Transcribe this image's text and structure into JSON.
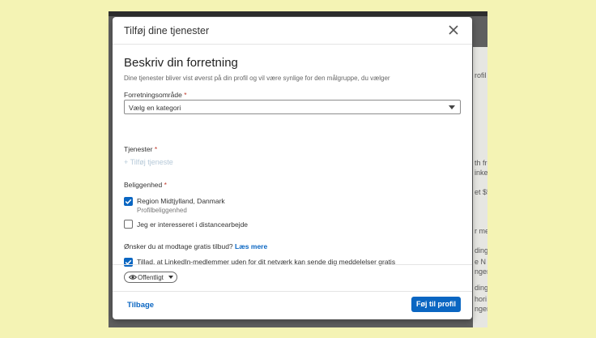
{
  "dialog": {
    "title": "Tilføj dine tjenester",
    "heading": "Beskriv din forretning",
    "subtitle": "Dine tjenester bliver vist øverst på din profil og vil være synlige for den målgruppe, du vælger",
    "required_mark": "*"
  },
  "business_area": {
    "label": "Forretningsområde",
    "selected": "Vælg en kategori"
  },
  "services": {
    "label": "Tjenester",
    "add_link": "+ Tilføj tjeneste"
  },
  "location": {
    "label": "Beliggenhed",
    "region": "Region Midtjylland, Danmark",
    "region_sub": "Profilbeliggenhed",
    "region_checked": true,
    "remote": "Jeg er interesseret i distancearbejde",
    "remote_checked": false
  },
  "offers": {
    "question": "Ønsker du at modtage gratis tilbud?",
    "learn_more": "Læs mere",
    "allow": "Tillad, at LinkedIn-medlemmer uden for dit netværk kan sende dig meddelelser gratis",
    "allow_checked": true
  },
  "footer": {
    "visibility": "Offentligt",
    "back": "Tilbage",
    "submit": "Føj til profil"
  },
  "background_peek": [
    "rofil",
    "th fre",
    "inke",
    "et $5",
    "r me",
    "ding",
    "e N",
    "nger",
    "ding",
    "hori",
    "nger"
  ],
  "colors": {
    "accent": "#0a66c2",
    "page_bg": "#f4f3b4",
    "overlay": "#5f5f5f"
  }
}
